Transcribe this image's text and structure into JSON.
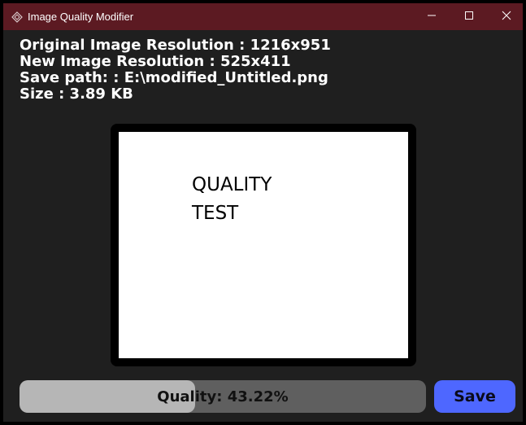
{
  "window": {
    "title": "Image Quality Modifier",
    "app_icon": "diamond-icon",
    "controls": {
      "minimize": "minimize-icon",
      "maximize": "maximize-icon",
      "close": "close-icon"
    },
    "titlebar_color": "#5c1a22"
  },
  "info": {
    "original_resolution": "Original Image Resolution : 1216x951",
    "new_resolution": "New Image Resolution : 525x411",
    "save_path": "Save path: : E:\\modified_Untitled.png",
    "size": "Size : 3.89 KB"
  },
  "preview": {
    "line1": "QUALITY",
    "line2": "TEST"
  },
  "quality_slider": {
    "label": "Quality: 43.22%",
    "value": 0.4322
  },
  "save_button": {
    "label": "Save",
    "color": "#4e67ff"
  }
}
